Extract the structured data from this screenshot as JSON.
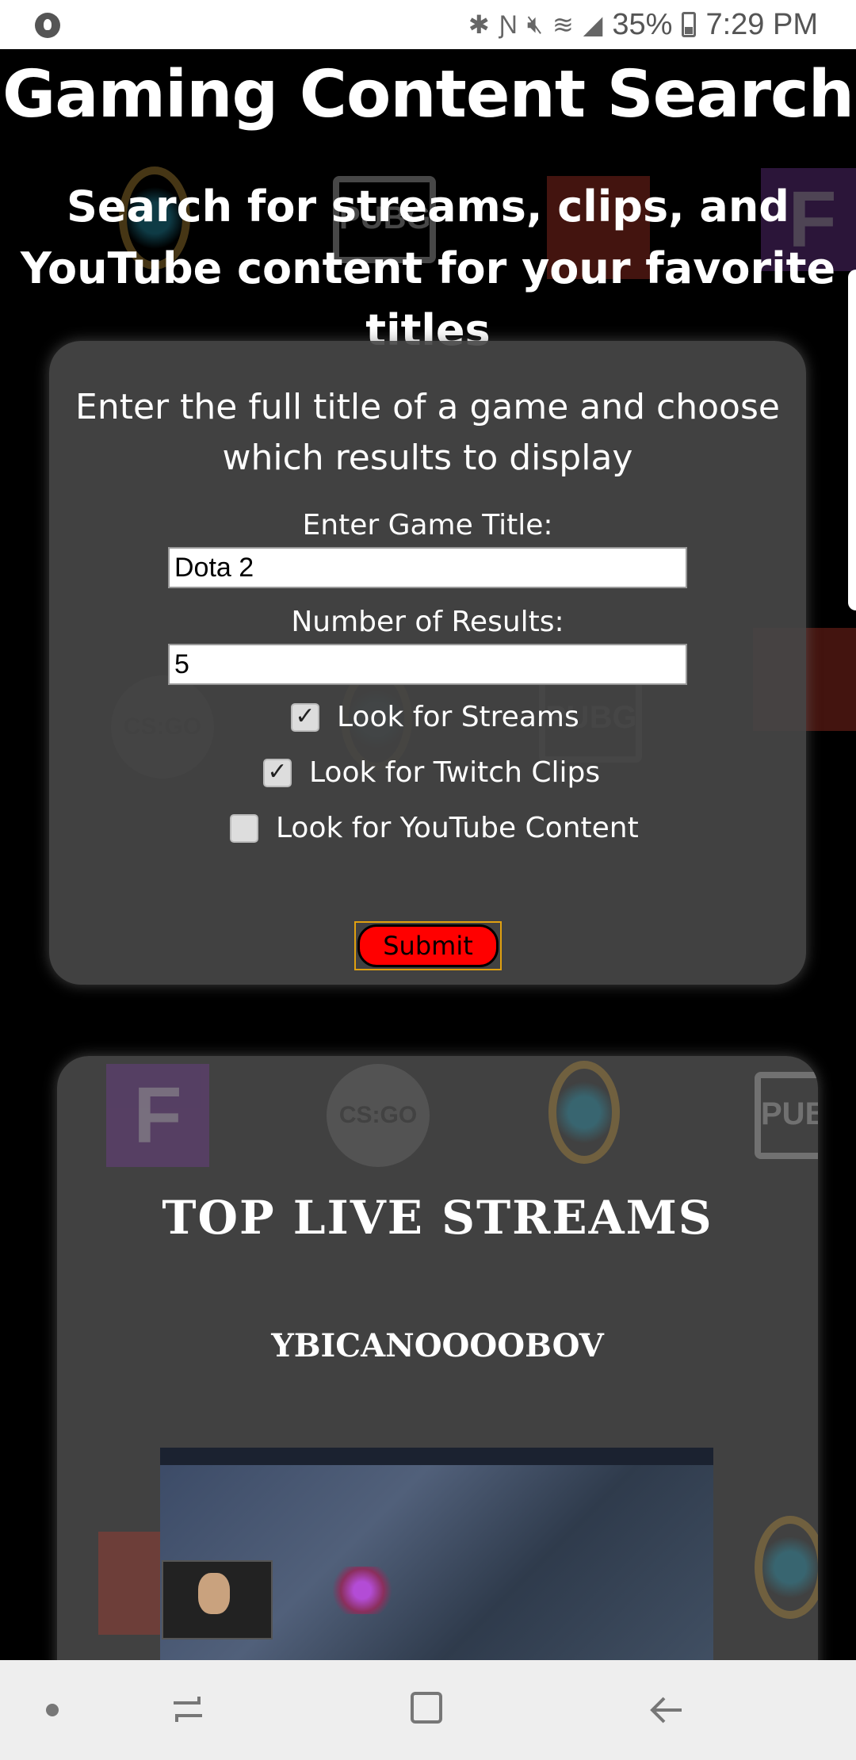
{
  "status_bar": {
    "battery": "35%",
    "time": "7:29 PM",
    "icons": [
      "music-icon",
      "bluetooth-icon",
      "nfc-icon",
      "mute-icon",
      "wifi-icon",
      "signal-icon",
      "battery-icon"
    ]
  },
  "header": {
    "title": "Gaming Content Search",
    "subtitle": "Search for streams, clips, and YouTube content for your favorite titles"
  },
  "search_form": {
    "intro": "Enter the full title of a game and choose which results to display",
    "game_title_label": "Enter Game Title:",
    "game_title_value": "Dota 2",
    "num_results_label": "Number of Results:",
    "num_results_value": "5",
    "options": [
      {
        "label": "Look for Streams",
        "checked": true
      },
      {
        "label": "Look for Twitch Clips",
        "checked": true
      },
      {
        "label": "Look for YouTube Content",
        "checked": false
      }
    ],
    "submit_label": "Submit"
  },
  "results": {
    "section_title": "TOP LIVE STREAMS",
    "streams": [
      {
        "name": "YBICANOOOOBOV"
      }
    ]
  },
  "background_logos": [
    "lol-logo",
    "pubg-logo",
    "dota-logo",
    "fortnite-logo",
    "csgo-logo"
  ],
  "colors": {
    "submit_bg": "#ff0000",
    "card_bg": "#464646",
    "page_bg": "#000000"
  }
}
